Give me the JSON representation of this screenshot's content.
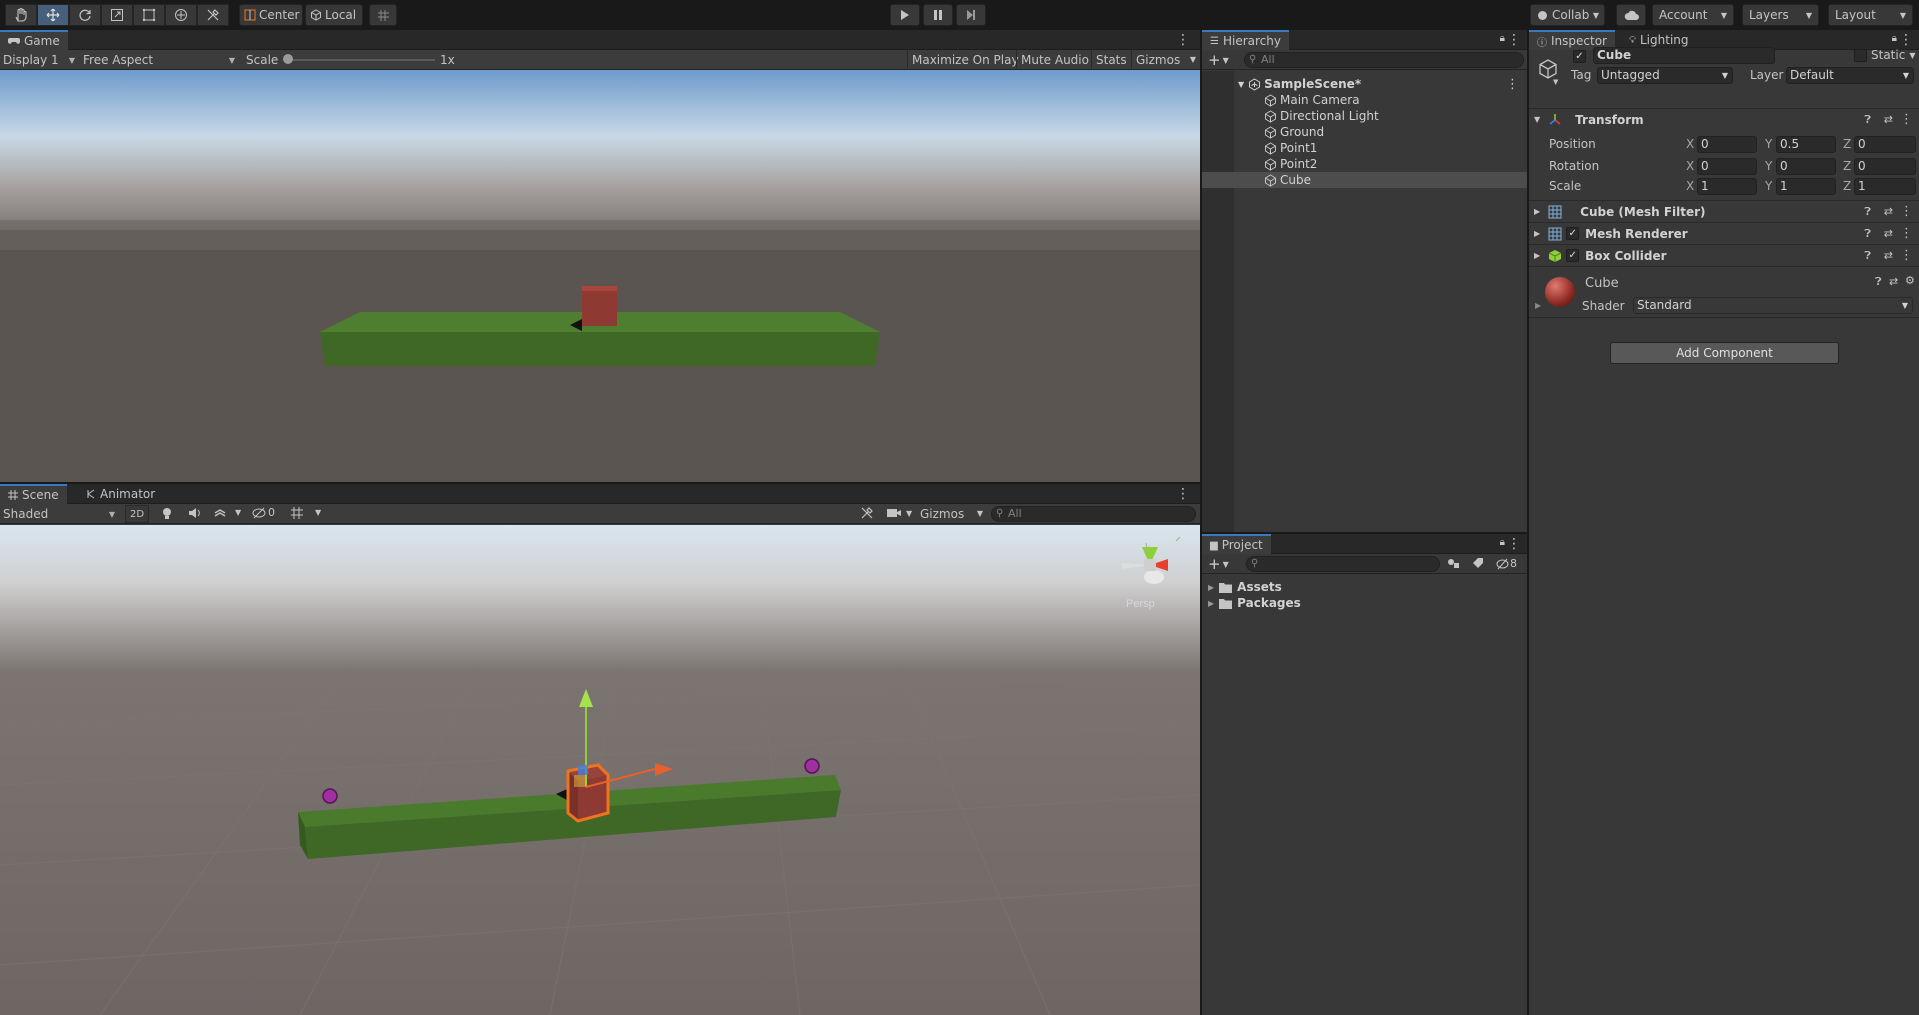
{
  "toolbar": {
    "pivot_center": "Center",
    "pivot_local": "Local",
    "collab": "Collab",
    "account": "Account",
    "layers": "Layers",
    "layout": "Layout"
  },
  "game": {
    "tab": "Game",
    "display": "Display 1",
    "aspect": "Free Aspect",
    "scale_label": "Scale",
    "scale_value": "1x",
    "scale_level": 0,
    "maximize": "Maximize On Play",
    "mute": "Mute Audio",
    "stats": "Stats",
    "gizmos": "Gizmos"
  },
  "scene": {
    "tab_scene": "Scene",
    "tab_animator": "Animator",
    "shading": "Shaded",
    "mode2d": "2D",
    "hidden_count": "0",
    "gizmos": "Gizmos",
    "search_placeholder": "All",
    "persp": "Persp"
  },
  "hierarchy": {
    "tab": "Hierarchy",
    "search_placeholder": "All",
    "scene_name": "SampleScene*",
    "items": [
      {
        "label": "Main Camera"
      },
      {
        "label": "Directional Light"
      },
      {
        "label": "Ground"
      },
      {
        "label": "Point1"
      },
      {
        "label": "Point2"
      },
      {
        "label": "Cube"
      }
    ]
  },
  "project": {
    "tab": "Project",
    "hidden_count": "8",
    "folders": [
      {
        "label": "Assets"
      },
      {
        "label": "Packages"
      }
    ]
  },
  "inspector": {
    "tab_inspector": "Inspector",
    "tab_lighting": "Lighting",
    "object_name": "Cube",
    "static_label": "Static",
    "tag_label": "Tag",
    "tag_value": "Untagged",
    "layer_label": "Layer",
    "layer_value": "Default",
    "transform": {
      "title": "Transform",
      "position_label": "Position",
      "rotation_label": "Rotation",
      "scale_label": "Scale",
      "x": "X",
      "y": "Y",
      "z": "Z",
      "position": [
        "0",
        "0.5",
        "0"
      ],
      "rotation": [
        "0",
        "0",
        "0"
      ],
      "scale": [
        "1",
        "1",
        "1"
      ]
    },
    "mesh_filter": "Cube (Mesh Filter)",
    "mesh_renderer": "Mesh Renderer",
    "box_collider": "Box Collider",
    "material_name": "Cube",
    "shader_label": "Shader",
    "shader_value": "Standard",
    "add_component": "Add Component"
  },
  "colors": {
    "accent": "#3a79bb",
    "ground": "#4a7a2c",
    "cube": "#8e3a33",
    "selection": "#f0731e"
  }
}
